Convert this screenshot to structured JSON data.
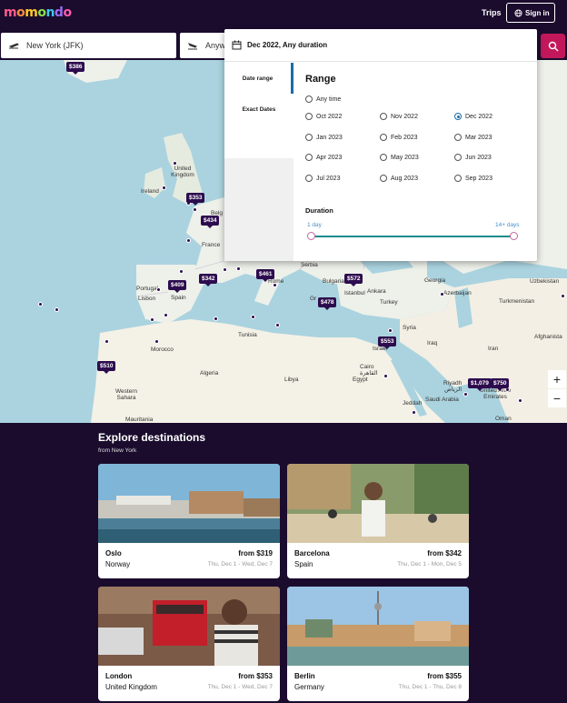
{
  "header": {
    "logo_letters": [
      "m",
      "o",
      "m",
      "o",
      "n",
      "d",
      "o"
    ],
    "logo_colors": [
      "#ff5a8a",
      "#ff8c42",
      "#ffc928",
      "#8be04e",
      "#3ec7e8",
      "#9b6cf0",
      "#ff5ab0"
    ],
    "trips_label": "Trips",
    "signin_label": "Sign in"
  },
  "search": {
    "from_value": "New York (JFK)",
    "to_value": "Anyw",
    "accent": "#c2185b"
  },
  "date_popup": {
    "header_label": "Dec 2022, Any duration",
    "tabs": [
      "Date range",
      "Exact Dates"
    ],
    "range_title": "Range",
    "any_time": "Any time",
    "months": [
      [
        "Oct 2022",
        "Nov 2022",
        "Dec 2022"
      ],
      [
        "Jan 2023",
        "Feb 2023",
        "Mar 2023"
      ],
      [
        "Apr 2023",
        "May 2023",
        "Jun 2023"
      ],
      [
        "Jul 2023",
        "Aug 2023",
        "Sep 2023"
      ]
    ],
    "selected_month": "Dec 2022",
    "duration_title": "Duration",
    "duration_min": "1 day",
    "duration_max": "14+ days"
  },
  "map": {
    "prices": [
      "$386",
      "$353",
      "$434",
      "$409",
      "$342",
      "$461",
      "$572",
      "$478",
      "$553",
      "$510",
      "$1,079",
      "$750"
    ],
    "labels": [
      "United Kingdom",
      "Ireland",
      "Belg",
      "France",
      "Portugal",
      "Lisbon",
      "Spain",
      "Serbia",
      "Bulgaria",
      "Istanbul",
      "Ankara",
      "Turkey",
      "Georgia",
      "Azerbaijan",
      "Uzbekistan",
      "Turkmenistan",
      "Afghanista",
      "Syria",
      "Israel",
      "Iraq",
      "Iran",
      "Morocco",
      "Tunisia",
      "Algeria",
      "Libya",
      "Egypt",
      "Cairo",
      "القاهرة",
      "Western Sahara",
      "Mauritania",
      "Riyadh",
      "الرياض",
      "Jeddah",
      "Saudi Arabia",
      "United Arab Emirates",
      "Oman",
      "Rome",
      "Gr"
    ],
    "zoom_in": "+",
    "zoom_out": "−"
  },
  "explore": {
    "title": "Explore destinations",
    "subtitle": "from New York",
    "cards": [
      {
        "city": "Oslo",
        "country": "Norway",
        "price": "from $319",
        "dates": "Thu, Dec 1 - Wed, Dec 7"
      },
      {
        "city": "Barcelona",
        "country": "Spain",
        "price": "from $342",
        "dates": "Thu, Dec 1 - Mon, Dec 5"
      },
      {
        "city": "London",
        "country": "United Kingdom",
        "price": "from $353",
        "dates": "Thu, Dec 1 - Wed, Dec 7"
      },
      {
        "city": "Berlin",
        "country": "Germany",
        "price": "from $355",
        "dates": "Thu, Dec 1 - Thu, Dec 8"
      }
    ]
  }
}
